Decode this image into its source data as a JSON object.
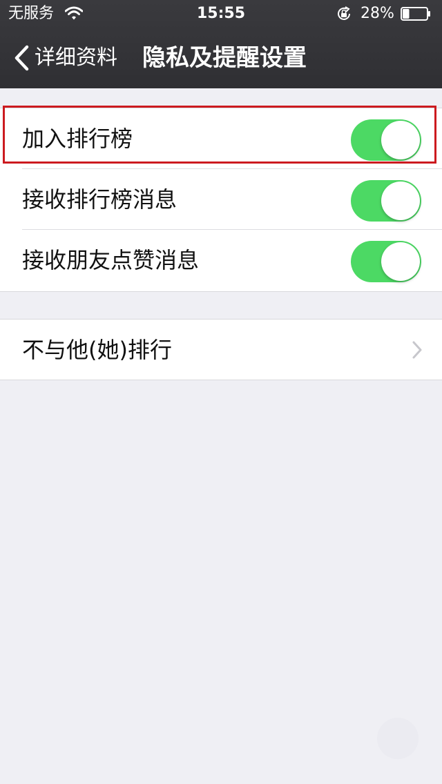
{
  "status_bar": {
    "carrier": "无服务",
    "time": "15:55",
    "battery_percent": "28%",
    "battery_level": 0.28
  },
  "nav": {
    "back_label": "详细资料",
    "title": "隐私及提醒设置"
  },
  "settings": {
    "group1": [
      {
        "label": "加入排行榜",
        "enabled": true
      },
      {
        "label": "接收排行榜消息",
        "enabled": true
      },
      {
        "label": "接收朋友点赞消息",
        "enabled": true
      }
    ],
    "group2": [
      {
        "label": "不与他(她)排行"
      }
    ]
  },
  "colors": {
    "toggle_on": "#4cd964",
    "highlight": "#cc1a1f",
    "nav_background": "#333337",
    "page_background": "#efeff4"
  },
  "icons": [
    "wifi-icon",
    "rotation-lock-icon",
    "battery-icon",
    "back-chevron-icon",
    "chevron-right-icon"
  ]
}
